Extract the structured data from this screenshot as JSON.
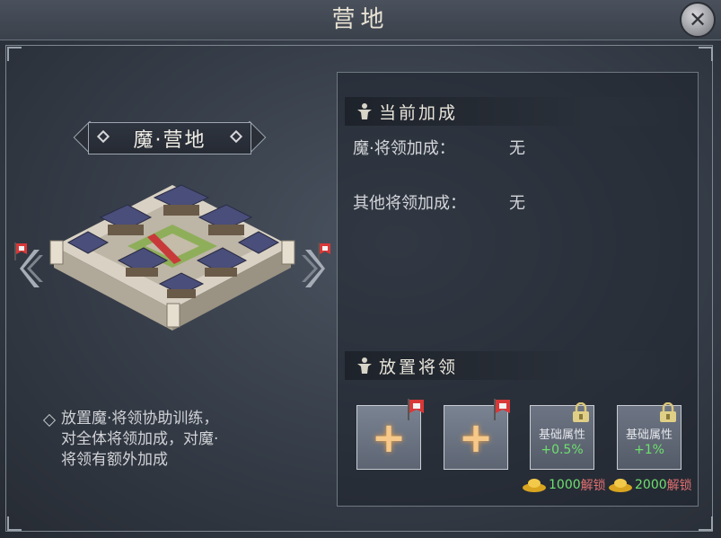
{
  "header": {
    "title": "营地"
  },
  "camp": {
    "name": "魔·营地",
    "description_lines": [
      "放置魔·将领协助训练，",
      "对全体将领加成，对魔·",
      "将领有额外加成"
    ]
  },
  "current_bonus": {
    "title": "当前加成",
    "rows": [
      {
        "label": "魔·将领加成：",
        "value": "无"
      },
      {
        "label": "其他将领加成：",
        "value": "无"
      }
    ]
  },
  "place_generals": {
    "title": "放置将领",
    "slots": [
      {
        "type": "empty"
      },
      {
        "type": "empty"
      },
      {
        "type": "locked",
        "label": "基础属性",
        "value": "+0.5%",
        "cost": "1000",
        "cost_label": "解锁"
      },
      {
        "type": "locked",
        "label": "基础属性",
        "value": "+1%",
        "cost": "2000",
        "cost_label": "解锁"
      }
    ]
  },
  "colors": {
    "bonus_green": "#6fe06f",
    "unlock_red": "#e07070",
    "plus_gold": "#f6c98a"
  },
  "icons": [
    "close-icon",
    "left-arrow-icon",
    "right-arrow-icon",
    "flag-icon",
    "general-icon",
    "lock-icon",
    "gold-ingot-icon"
  ]
}
